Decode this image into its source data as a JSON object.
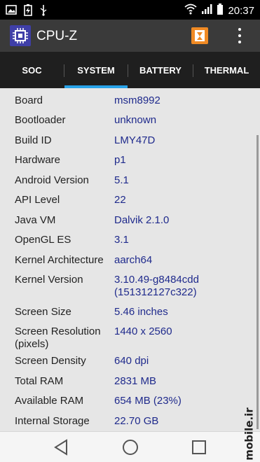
{
  "status_bar": {
    "time": "20:37",
    "left_icons": [
      "image-icon",
      "battery-charging-icon",
      "usb-icon"
    ],
    "right_icons": [
      "wifi-icon",
      "signal-icon",
      "battery-icon"
    ]
  },
  "app_bar": {
    "title": "CPU-Z",
    "logo_icon": "cpu-chip-icon",
    "actions": [
      "benchmark-icon",
      "overflow-menu-icon"
    ]
  },
  "tabs": [
    {
      "label": "SOC",
      "active": false
    },
    {
      "label": "SYSTEM",
      "active": true
    },
    {
      "label": "BATTERY",
      "active": false
    },
    {
      "label": "THERMAL",
      "active": false
    }
  ],
  "rows": [
    {
      "label": "Board",
      "value": "msm8992"
    },
    {
      "label": "Bootloader",
      "value": "unknown"
    },
    {
      "label": "Build ID",
      "value": "LMY47D"
    },
    {
      "label": "Hardware",
      "value": "p1"
    },
    {
      "label": "Android Version",
      "value": "5.1"
    },
    {
      "label": "API Level",
      "value": "22"
    },
    {
      "label": "Java VM",
      "value": "Dalvik 2.1.0"
    },
    {
      "label": "OpenGL ES",
      "value": "3.1"
    },
    {
      "label": "Kernel Architecture",
      "value": "aarch64"
    },
    {
      "label": "Kernel Version",
      "value": "3.10.49-g8484cdd\n(151312127c322)"
    },
    {
      "label": "Screen Size",
      "value": "5.46 inches"
    },
    {
      "label": "Screen Resolution\n(pixels)",
      "value": "1440 x 2560"
    },
    {
      "label": "Screen Density",
      "value": "640 dpi"
    },
    {
      "label": "Total RAM",
      "value": "2831 MB"
    },
    {
      "label": "Available RAM",
      "value": "654 MB  (23%)"
    },
    {
      "label": "Internal Storage",
      "value": "22.70 GB"
    }
  ],
  "nav_bar": {
    "buttons": [
      "back-icon",
      "home-icon",
      "recents-icon"
    ]
  },
  "watermark": "mobile.ir",
  "colors": {
    "status_bar": "#000000",
    "app_bar": "#3a3a3a",
    "tab_bar": "#1f1f1f",
    "tab_indicator": "#29a3e8",
    "background": "#e6e6e6",
    "label_text": "#222222",
    "value_text": "#1f2a8c",
    "benchmark_button": "#f08a24"
  }
}
